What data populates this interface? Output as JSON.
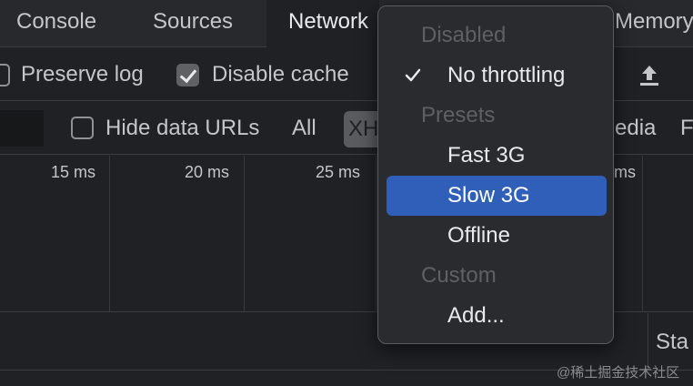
{
  "tabs": {
    "console": "Console",
    "sources": "Sources",
    "network": "Network",
    "memory": "Memory"
  },
  "toolbar": {
    "preserve_log": "Preserve log",
    "disable_cache": "Disable cache",
    "preserve_log_checked": false,
    "disable_cache_checked": true,
    "upload_icon": "upload-icon"
  },
  "filters": {
    "hide_data_urls": "Hide data URLs",
    "all": "All",
    "xhr": "XH",
    "media": "edia",
    "font": "F"
  },
  "overview": {
    "ticks": [
      "15 ms",
      "20 ms",
      "25 ms",
      "ms"
    ]
  },
  "table": {
    "status_header": "Sta"
  },
  "throttling_menu": {
    "items": [
      {
        "label": "Disabled",
        "type": "header"
      },
      {
        "label": "No throttling",
        "type": "option",
        "checked": true
      },
      {
        "label": "Presets",
        "type": "header"
      },
      {
        "label": "Fast 3G",
        "type": "option"
      },
      {
        "label": "Slow 3G",
        "type": "option",
        "highlighted": true
      },
      {
        "label": "Offline",
        "type": "option"
      },
      {
        "label": "Custom",
        "type": "header"
      },
      {
        "label": "Add...",
        "type": "option"
      }
    ]
  },
  "watermark": "@稀土掘金技术社区",
  "colors": {
    "background": "#202124",
    "highlight": "#2f5fb8",
    "menu_background": "#2a2b2e",
    "text": "#c5c6c9",
    "disabled_text": "#5f6063"
  }
}
